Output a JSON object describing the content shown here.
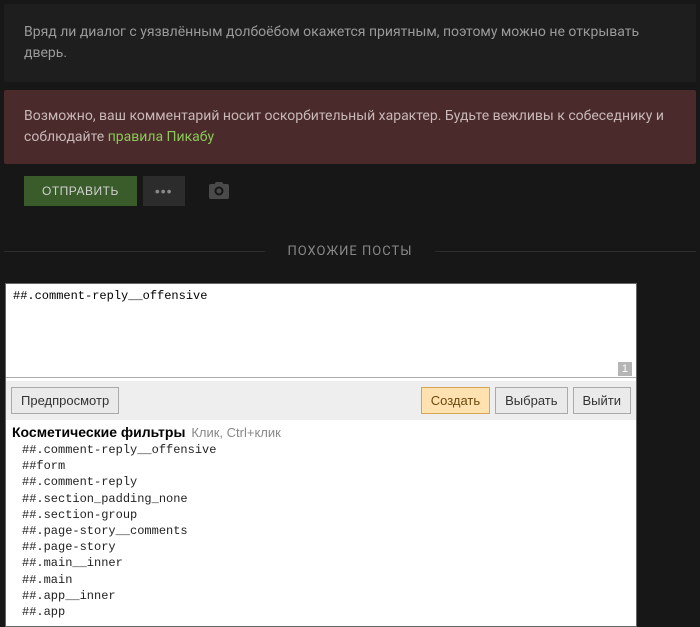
{
  "comment": {
    "text": "Вряд ли диалог с уязвлённым долбоёбом окажется приятным, поэтому можно не открывать дверь."
  },
  "warning": {
    "prefix": "Возможно, ваш комментарий носит оскорбительный характер. Будьте вежливы к собеседнику и соблюдайте ",
    "link_text": "правила Пикабу"
  },
  "actions": {
    "send": "ОТПРАВИТЬ",
    "more": "•••"
  },
  "divider": {
    "label": "ПОХОЖИЕ ПОСТЫ"
  },
  "picker": {
    "textarea_value": "##.comment-reply__offensive",
    "counter": "1",
    "buttons": {
      "preview": "Предпросмотр",
      "create": "Создать",
      "select": "Выбрать",
      "exit": "Выйти"
    },
    "filters_title": "Косметические фильтры",
    "filters_hint": "Клик, Ctrl+клик",
    "filters": [
      "##.comment-reply__offensive",
      "##form",
      "##.comment-reply",
      "##.section_padding_none",
      "##.section-group",
      "##.page-story__comments",
      "##.page-story",
      "##.main__inner",
      "##.main",
      "##.app__inner",
      "##.app"
    ]
  }
}
